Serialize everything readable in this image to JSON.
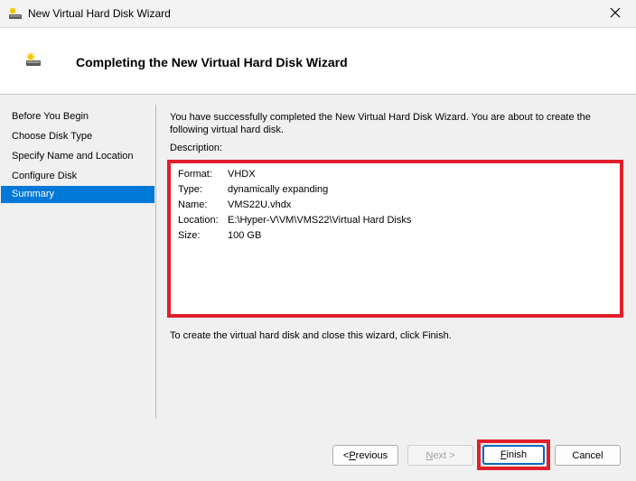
{
  "window": {
    "title": "New Virtual Hard Disk Wizard"
  },
  "header": {
    "title": "Completing the New Virtual Hard Disk Wizard"
  },
  "nav": {
    "items": [
      {
        "label": "Before You Begin"
      },
      {
        "label": "Choose Disk Type"
      },
      {
        "label": "Specify Name and Location"
      },
      {
        "label": "Configure Disk"
      },
      {
        "label": "Summary"
      }
    ],
    "selected": "Summary"
  },
  "content": {
    "intro": "You have successfully completed the New Virtual Hard Disk Wizard. You are about to create the following virtual hard disk.",
    "description_label": "Description:",
    "description": [
      {
        "key": "Format:",
        "value": "VHDX"
      },
      {
        "key": "Type:",
        "value": "dynamically expanding"
      },
      {
        "key": "Name:",
        "value": "VMS22U.vhdx"
      },
      {
        "key": "Location:",
        "value": "E:\\Hyper-V\\VM\\VMS22\\Virtual Hard Disks"
      },
      {
        "key": "Size:",
        "value": "100 GB"
      }
    ],
    "finish_note": "To create the virtual hard disk and close this wizard, click Finish."
  },
  "buttons": {
    "previous": {
      "prefix": "< ",
      "mnemonic": "P",
      "rest": "revious"
    },
    "next": {
      "mnemonic": "N",
      "rest": "ext >"
    },
    "finish": {
      "mnemonic": "F",
      "rest": "inish"
    },
    "cancel": "Cancel"
  },
  "colors": {
    "accent": "#0078d7",
    "highlight": "#e01f2c"
  },
  "icons": {
    "app": "virtual-disk-icon",
    "close": "close-icon"
  }
}
